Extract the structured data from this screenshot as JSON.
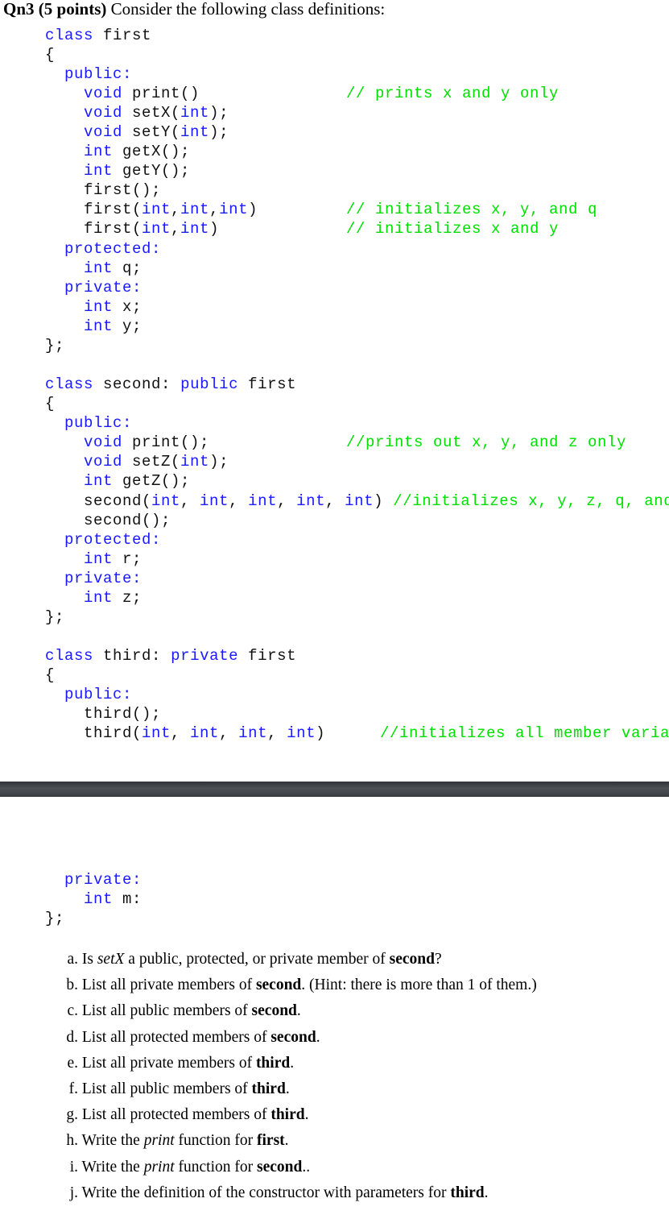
{
  "heading": {
    "number": "Qn3",
    "points": "(5 points)",
    "text": "Consider the following class definitions:"
  },
  "colors": {
    "keyword": "#1a1aff",
    "comment": "#00e000",
    "divider": "#45494d"
  },
  "class_first": {
    "header_kw": "class",
    "header_name": "first",
    "open_brace": "{",
    "public_label": "public:",
    "members": {
      "print_kw": "void",
      "print_name": "print()",
      "print_comment": "// prints x and y only",
      "setx_kw": "void",
      "setx_name": "setX(",
      "setx_param": "int",
      "setx_end": ");",
      "sety_kw": "void",
      "sety_name": "setY(",
      "sety_param": "int",
      "sety_end": ");",
      "getx_kw": "int",
      "getx_name": "getX();",
      "gety_kw": "int",
      "gety_name": "getY();",
      "ctor0": "first();",
      "ctor3_name": "first(",
      "ctor3_p1": "int",
      "ctor3_p2": "int",
      "ctor3_p3": "int",
      "ctor3_end": ")",
      "ctor3_comment": "// initializes x, y, and q",
      "ctor2_name": "first(",
      "ctor2_p1": "int",
      "ctor2_p2": "int",
      "ctor2_end": ")",
      "ctor2_comment": "// initializes x and y"
    },
    "protected_label": "protected:",
    "protected_kw": "int",
    "protected_var": "q;",
    "private_label": "private:",
    "private_kw1": "int",
    "private_var1": "x;",
    "private_kw2": "int",
    "private_var2": "y;",
    "close_brace": "};"
  },
  "class_second": {
    "header_kw": "class",
    "header_name": "second:",
    "header_access": "public",
    "header_base": "first",
    "open_brace": "{",
    "public_label": "public:",
    "print_kw": "void",
    "print_name": "print();",
    "print_comment": "//prints out x, y, and z only",
    "setz_kw": "void",
    "setz_name": "setZ(",
    "setz_param": "int",
    "setz_end": ");",
    "getz_kw": "int",
    "getz_name": "getZ();",
    "ctor5_name": "second(",
    "ctor5_param": "int",
    "ctor5_end": ")",
    "ctor5_comment": "//initializes x, y, z, q, and r",
    "ctor0": "second();",
    "protected_label": "protected:",
    "protected_kw": "int",
    "protected_var": "r;",
    "private_label": "private:",
    "private_kw": "int",
    "private_var": "z;",
    "close_brace": "};"
  },
  "class_third": {
    "header_kw": "class",
    "header_name": "third:",
    "header_access": "private",
    "header_base": "first",
    "open_brace": "{",
    "public_label": "public:",
    "ctor0": "third();",
    "ctor4_name": "third(",
    "ctor4_param": "int",
    "ctor4_end": ")",
    "ctor4_comment": "//initializes all member variables",
    "private_label": "private:",
    "private_kw": "int",
    "private_var": "m:",
    "close_brace": "};"
  },
  "questions": [
    {
      "label": "a.",
      "pre": "Is ",
      "italic": "setX",
      "mid": " a public, protected, or private member of ",
      "bold": "second",
      "post": "?"
    },
    {
      "label": "b.",
      "pre": "List all private members of ",
      "italic": "",
      "mid": "",
      "bold": "second",
      "post": ". (Hint: there is more than 1 of them.)"
    },
    {
      "label": "c.",
      "pre": "List all public members of ",
      "italic": "",
      "mid": "",
      "bold": "second",
      "post": "."
    },
    {
      "label": "d.",
      "pre": "List all protected members of ",
      "italic": "",
      "mid": "",
      "bold": "second",
      "post": "."
    },
    {
      "label": "e.",
      "pre": "List all private members of ",
      "italic": "",
      "mid": "",
      "bold": "third",
      "post": "."
    },
    {
      "label": "f.",
      "pre": "List all public members of ",
      "italic": "",
      "mid": "",
      "bold": "third",
      "post": "."
    },
    {
      "label": "g.",
      "pre": "List all protected members of ",
      "italic": "",
      "mid": "",
      "bold": "third",
      "post": "."
    },
    {
      "label": "h.",
      "pre": "Write the ",
      "italic": "print",
      "mid": " function for ",
      "bold": "first",
      "post": "."
    },
    {
      "label": "i.",
      "pre": "Write the ",
      "italic": "print",
      "mid": " function for ",
      "bold": "second",
      "post": ".."
    },
    {
      "label": "j.",
      "pre": "Write the definition of the constructor with parameters for ",
      "italic": "",
      "mid": "",
      "bold": "third",
      "post": "."
    }
  ]
}
